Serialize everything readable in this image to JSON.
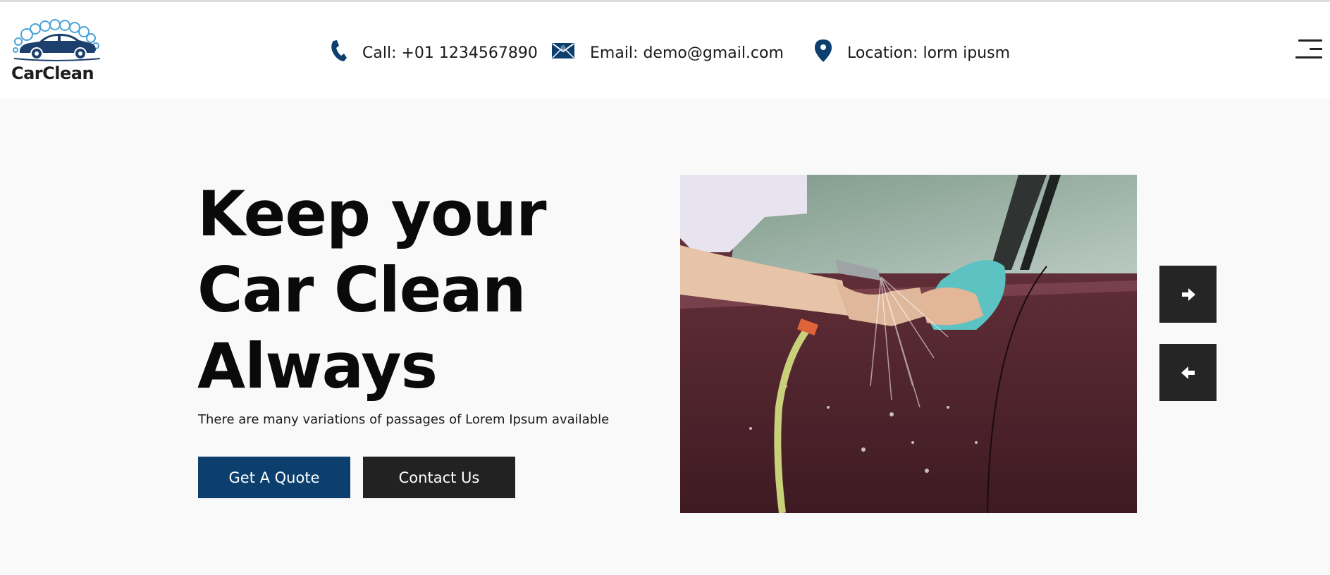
{
  "brand": {
    "name": "CarClean"
  },
  "contact": {
    "phone": "Call: +01 1234567890",
    "email": "Email: demo@gmail.com",
    "location": "Location: lorm ipusm"
  },
  "hero": {
    "title_lines": [
      "Keep your",
      "Car Clean",
      "Always"
    ],
    "subtitle": "There are many variations of passages of Lorem Ipsum available",
    "quote_button": "Get A Quote",
    "contact_button": "Contact Us"
  },
  "icons": {
    "phone": "phone-icon",
    "email": "envelope-icon",
    "location": "map-pin-icon",
    "menu": "hamburger-menu-icon",
    "next": "arrow-right-icon",
    "prev": "arrow-left-icon"
  },
  "colors": {
    "brand_blue": "#0c3f6e",
    "dark": "#222222",
    "background": "#f9f9f9",
    "header_bg": "#ffffff"
  }
}
